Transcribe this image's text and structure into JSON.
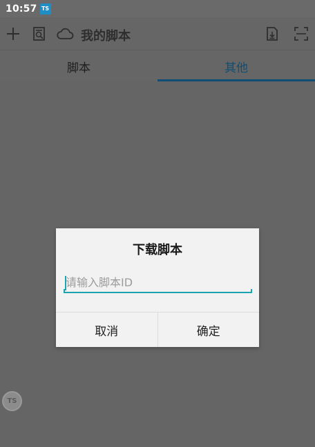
{
  "status_bar": {
    "time": "10:57",
    "app_badge": "TS"
  },
  "toolbar": {
    "title": "我的脚本",
    "icons": [
      "add-icon",
      "search-document-icon",
      "cloud-icon",
      "download-file-icon",
      "scan-icon"
    ]
  },
  "tabs": [
    {
      "label": "脚本",
      "active": false
    },
    {
      "label": "其他",
      "active": true
    }
  ],
  "floating_ball": {
    "label": "TS"
  },
  "dialog": {
    "title": "下载脚本",
    "input": {
      "value": "",
      "placeholder": "请输入脚本ID"
    },
    "buttons": {
      "cancel": "取消",
      "confirm": "确定"
    }
  },
  "colors": {
    "overlay": "#666666",
    "accent": "#1aa3b0",
    "tab_active": "#0f4e74",
    "dialog_bg": "#f2f2f2"
  }
}
